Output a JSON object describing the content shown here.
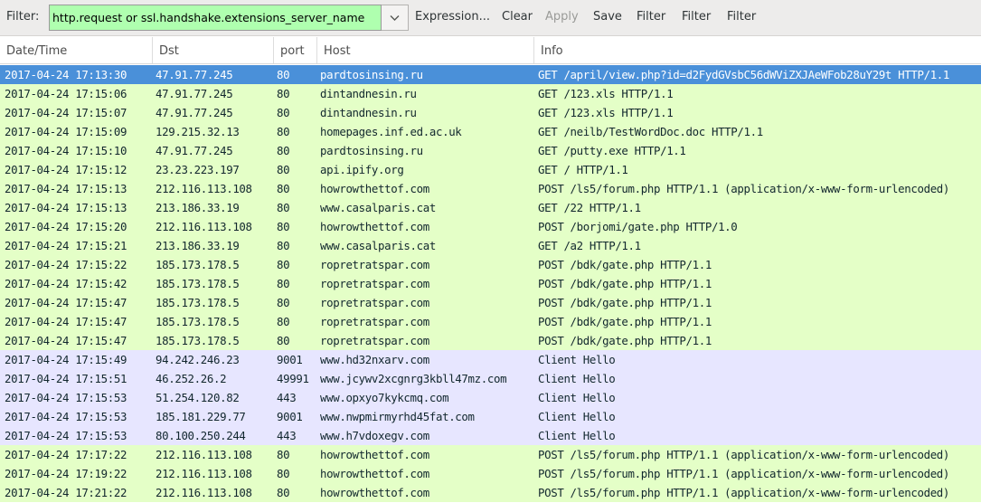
{
  "toolbar": {
    "filter_label": "Filter:",
    "filter_value": "http.request or ssl.handshake.extensions_server_name",
    "expression_label": "Expression...",
    "clear_label": "Clear",
    "apply_label": "Apply",
    "save_label": "Save",
    "button1_label": "Filter",
    "button2_label": "Filter",
    "button3_label": "Filter"
  },
  "columns": [
    "Date/Time",
    "Dst",
    "port",
    "Host",
    "Info"
  ],
  "colors": {
    "http_row": "#e4ffc7",
    "tls_row": "#e7e6ff",
    "selected_row": "#4a90d9",
    "filter_valid": "#afffaf"
  },
  "rows": [
    {
      "dt": "2017-04-24 17:13:30",
      "dst": "47.91.77.245",
      "port": "80",
      "host": "pardtosinsing.ru",
      "info": "GET /april/view.php?id=d2FydGVsbC56dWViZXJAeWFob28uY29t HTTP/1.1",
      "kind": "sel"
    },
    {
      "dt": "2017-04-24 17:15:06",
      "dst": "47.91.77.245",
      "port": "80",
      "host": "dintandnesin.ru",
      "info": "GET /123.xls HTTP/1.1",
      "kind": "http"
    },
    {
      "dt": "2017-04-24 17:15:07",
      "dst": "47.91.77.245",
      "port": "80",
      "host": "dintandnesin.ru",
      "info": "GET /123.xls HTTP/1.1",
      "kind": "http"
    },
    {
      "dt": "2017-04-24 17:15:09",
      "dst": "129.215.32.13",
      "port": "80",
      "host": "homepages.inf.ed.ac.uk",
      "info": "GET /neilb/TestWordDoc.doc HTTP/1.1",
      "kind": "http"
    },
    {
      "dt": "2017-04-24 17:15:10",
      "dst": "47.91.77.245",
      "port": "80",
      "host": "pardtosinsing.ru",
      "info": "GET /putty.exe HTTP/1.1",
      "kind": "http"
    },
    {
      "dt": "2017-04-24 17:15:12",
      "dst": "23.23.223.197",
      "port": "80",
      "host": "api.ipify.org",
      "info": "GET / HTTP/1.1",
      "kind": "http"
    },
    {
      "dt": "2017-04-24 17:15:13",
      "dst": "212.116.113.108",
      "port": "80",
      "host": "howrowthettof.com",
      "info": "POST /ls5/forum.php HTTP/1.1  (application/x-www-form-urlencoded)",
      "kind": "http"
    },
    {
      "dt": "2017-04-24 17:15:13",
      "dst": "213.186.33.19",
      "port": "80",
      "host": "www.casalparis.cat",
      "info": "GET /22 HTTP/1.1",
      "kind": "http"
    },
    {
      "dt": "2017-04-24 17:15:20",
      "dst": "212.116.113.108",
      "port": "80",
      "host": "howrowthettof.com",
      "info": "POST /borjomi/gate.php HTTP/1.0",
      "kind": "http"
    },
    {
      "dt": "2017-04-24 17:15:21",
      "dst": "213.186.33.19",
      "port": "80",
      "host": "www.casalparis.cat",
      "info": "GET /a2 HTTP/1.1",
      "kind": "http"
    },
    {
      "dt": "2017-04-24 17:15:22",
      "dst": "185.173.178.5",
      "port": "80",
      "host": "ropretratspar.com",
      "info": "POST /bdk/gate.php HTTP/1.1",
      "kind": "http"
    },
    {
      "dt": "2017-04-24 17:15:42",
      "dst": "185.173.178.5",
      "port": "80",
      "host": "ropretratspar.com",
      "info": "POST /bdk/gate.php HTTP/1.1",
      "kind": "http"
    },
    {
      "dt": "2017-04-24 17:15:47",
      "dst": "185.173.178.5",
      "port": "80",
      "host": "ropretratspar.com",
      "info": "POST /bdk/gate.php HTTP/1.1",
      "kind": "http"
    },
    {
      "dt": "2017-04-24 17:15:47",
      "dst": "185.173.178.5",
      "port": "80",
      "host": "ropretratspar.com",
      "info": "POST /bdk/gate.php HTTP/1.1",
      "kind": "http"
    },
    {
      "dt": "2017-04-24 17:15:47",
      "dst": "185.173.178.5",
      "port": "80",
      "host": "ropretratspar.com",
      "info": "POST /bdk/gate.php HTTP/1.1",
      "kind": "http"
    },
    {
      "dt": "2017-04-24 17:15:49",
      "dst": "94.242.246.23",
      "port": "9001",
      "host": "www.hd32nxarv.com",
      "info": "Client Hello",
      "kind": "tls"
    },
    {
      "dt": "2017-04-24 17:15:51",
      "dst": "46.252.26.2",
      "port": "49991",
      "host": "www.jcywv2xcgnrg3kbll47mz.com",
      "info": "Client Hello",
      "kind": "tls"
    },
    {
      "dt": "2017-04-24 17:15:53",
      "dst": "51.254.120.82",
      "port": "443",
      "host": "www.opxyo7kykcmq.com",
      "info": "Client Hello",
      "kind": "tls"
    },
    {
      "dt": "2017-04-24 17:15:53",
      "dst": "185.181.229.77",
      "port": "9001",
      "host": "www.nwpmirmyrhd45fat.com",
      "info": "Client Hello",
      "kind": "tls"
    },
    {
      "dt": "2017-04-24 17:15:53",
      "dst": "80.100.250.244",
      "port": "443",
      "host": "www.h7vdoxegv.com",
      "info": "Client Hello",
      "kind": "tls"
    },
    {
      "dt": "2017-04-24 17:17:22",
      "dst": "212.116.113.108",
      "port": "80",
      "host": "howrowthettof.com",
      "info": "POST /ls5/forum.php HTTP/1.1  (application/x-www-form-urlencoded)",
      "kind": "http"
    },
    {
      "dt": "2017-04-24 17:19:22",
      "dst": "212.116.113.108",
      "port": "80",
      "host": "howrowthettof.com",
      "info": "POST /ls5/forum.php HTTP/1.1  (application/x-www-form-urlencoded)",
      "kind": "http"
    },
    {
      "dt": "2017-04-24 17:21:22",
      "dst": "212.116.113.108",
      "port": "80",
      "host": "howrowthettof.com",
      "info": "POST /ls5/forum.php HTTP/1.1  (application/x-www-form-urlencoded)",
      "kind": "http"
    }
  ]
}
